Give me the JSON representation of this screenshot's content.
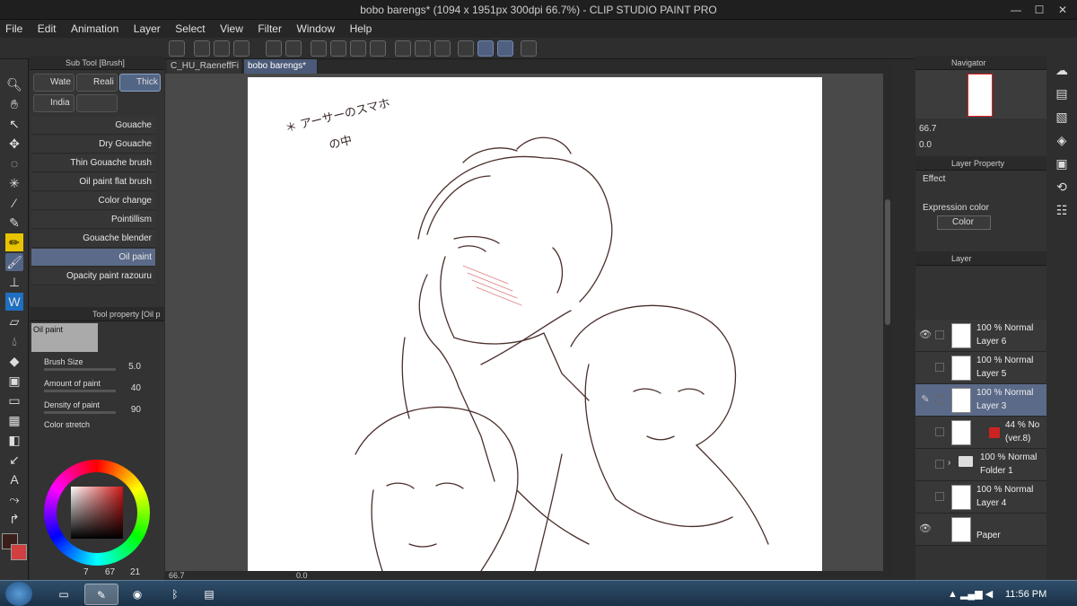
{
  "window": {
    "title": "bobo barengs* (1094 x 1951px 300dpi 66.7%) - CLIP STUDIO PAINT PRO"
  },
  "menu": [
    "File",
    "Edit",
    "Animation",
    "Layer",
    "Select",
    "View",
    "Filter",
    "Window",
    "Help"
  ],
  "subtool": {
    "header": "Sub Tool [Brush]",
    "groups": [
      "Wate",
      "Reali",
      "Thick",
      "India"
    ],
    "brushes": [
      "Gouache",
      "Dry Gouache",
      "Thin Gouache brush",
      "Oil paint flat brush",
      "Color change",
      "Pointillism",
      "Gouache blender",
      "Oil paint",
      "Opacity paint razouru"
    ]
  },
  "tool_property": {
    "header": "Tool property [Oil p",
    "preview_label": "Oil paint",
    "rows": [
      {
        "label": "Brush Size",
        "value": "5.0"
      },
      {
        "label": "Amount of paint",
        "value": "40"
      },
      {
        "label": "Density of paint",
        "value": "90"
      },
      {
        "label": "Color stretch",
        "value": ""
      }
    ]
  },
  "color": {
    "main": "#3a1e1a",
    "sub": "#d04040",
    "picker_hue": "#d01818",
    "readouts": [
      "7",
      "67",
      "21"
    ]
  },
  "tabs": [
    "C_HU_RaeneffFi",
    "bobo barengs*"
  ],
  "canvas": {
    "note_line1": "＊ アーサーのスマホ",
    "note_line2": "の中"
  },
  "status": {
    "zoom": "66.7",
    "angle": "0.0"
  },
  "navigator": {
    "header": "Navigator",
    "zoom": "66.7",
    "angle": "0.0"
  },
  "layer_property": {
    "header": "Layer Property",
    "effect_label": "Effect",
    "expression_label": "Expression color",
    "color_btn": "Color"
  },
  "layers": {
    "header": "Layer",
    "items": [
      {
        "a": "100 % Normal",
        "b": "Layer 6"
      },
      {
        "a": "100 % Normal",
        "b": "Layer 5"
      },
      {
        "a": "100 % Normal",
        "b": "Layer 3"
      },
      {
        "a": "44 % No",
        "b": "(ver.8)"
      },
      {
        "a": "100 % Normal",
        "b": "Folder 1"
      },
      {
        "a": "100 % Normal",
        "b": "Layer 4"
      },
      {
        "a": "",
        "b": "Paper"
      }
    ]
  },
  "taskbar": {
    "time": "11:56 PM"
  }
}
